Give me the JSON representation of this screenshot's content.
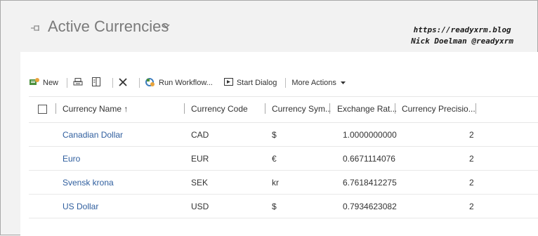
{
  "header": {
    "title": "Active Currencies",
    "watermark_line1": "https://readyxrm.blog",
    "watermark_line2": "Nick Doelman @readyxrm"
  },
  "toolbar": {
    "new_label": "New",
    "run_workflow_label": "Run Workflow...",
    "start_dialog_label": "Start Dialog",
    "more_actions_label": "More Actions"
  },
  "grid": {
    "columns": [
      "Currency Name ↑",
      "Currency Code",
      "Currency Sym...",
      "Exchange Rat...",
      "Currency Precisio..."
    ],
    "rows": [
      {
        "name": "Canadian Dollar",
        "code": "CAD",
        "symbol": "$",
        "rate": "1.0000000000",
        "precision": "2"
      },
      {
        "name": "Euro",
        "code": "EUR",
        "symbol": "€",
        "rate": "0.6671114076",
        "precision": "2"
      },
      {
        "name": "Svensk krona",
        "code": "SEK",
        "symbol": "kr",
        "rate": "6.7618412275",
        "precision": "2"
      },
      {
        "name": "US Dollar",
        "code": "USD",
        "symbol": "$",
        "rate": "0.7934623082",
        "precision": "2"
      }
    ]
  }
}
